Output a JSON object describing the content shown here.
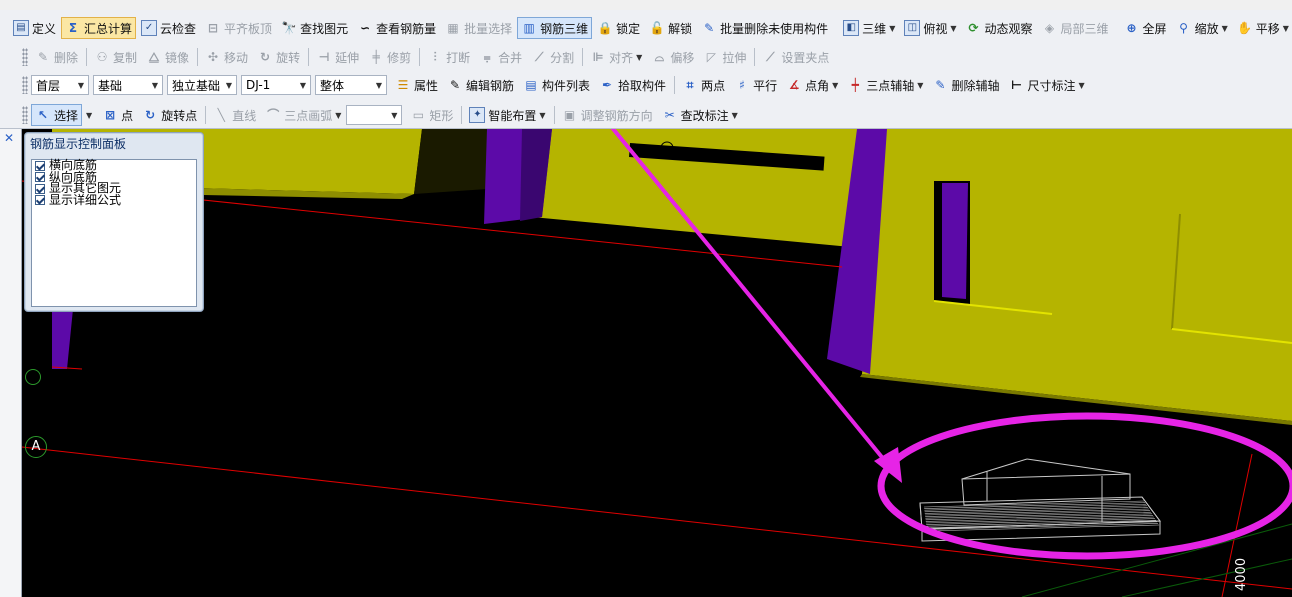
{
  "toolbar1": {
    "items": [
      {
        "label": "定义",
        "icon": "define-icon"
      },
      {
        "label": "汇总计算",
        "icon": "sigma-icon"
      },
      {
        "label": "云检查",
        "icon": "cloud-check-icon"
      },
      {
        "label": "平齐板顶",
        "icon": "align-slab-icon"
      },
      {
        "label": "查找图元",
        "icon": "binoculars-icon"
      },
      {
        "label": "查看钢筋量",
        "icon": "rebar-quantity-icon"
      },
      {
        "label": "批量选择",
        "icon": "batch-select-icon"
      },
      {
        "label": "钢筋三维",
        "icon": "rebar-3d-icon"
      },
      {
        "label": "锁定",
        "icon": "lock-icon"
      },
      {
        "label": "解锁",
        "icon": "unlock-icon"
      },
      {
        "label": "批量删除未使用构件",
        "icon": "batch-delete-icon"
      },
      {
        "label": "三维",
        "icon": "cube-icon"
      },
      {
        "label": "俯视",
        "icon": "top-view-icon"
      },
      {
        "label": "动态观察",
        "icon": "orbit-icon"
      },
      {
        "label": "局部三维",
        "icon": "local-3d-icon"
      },
      {
        "label": "全屏",
        "icon": "zoom-extents-icon"
      },
      {
        "label": "缩放",
        "icon": "zoom-icon"
      },
      {
        "label": "平移",
        "icon": "pan-icon"
      }
    ]
  },
  "toolbar2": {
    "items": [
      {
        "label": "删除",
        "icon": "delete-icon"
      },
      {
        "label": "复制",
        "icon": "copy-icon"
      },
      {
        "label": "镜像",
        "icon": "mirror-icon"
      },
      {
        "label": "移动",
        "icon": "move-icon"
      },
      {
        "label": "旋转",
        "icon": "rotate-icon"
      },
      {
        "label": "延伸",
        "icon": "extend-icon"
      },
      {
        "label": "修剪",
        "icon": "trim-icon"
      },
      {
        "label": "打断",
        "icon": "break-icon"
      },
      {
        "label": "合并",
        "icon": "merge-icon"
      },
      {
        "label": "分割",
        "icon": "split-icon"
      },
      {
        "label": "对齐",
        "icon": "align-icon"
      },
      {
        "label": "偏移",
        "icon": "offset-icon"
      },
      {
        "label": "拉伸",
        "icon": "stretch-icon"
      },
      {
        "label": "设置夹点",
        "icon": "grip-point-icon"
      }
    ]
  },
  "toolbar3": {
    "floor": "首层",
    "category": "基础",
    "type": "独立基础",
    "component": "DJ-1",
    "scope": "整体",
    "items": [
      {
        "label": "属性",
        "icon": "properties-icon"
      },
      {
        "label": "编辑钢筋",
        "icon": "edit-rebar-icon"
      },
      {
        "label": "构件列表",
        "icon": "component-list-icon"
      },
      {
        "label": "拾取构件",
        "icon": "pick-icon"
      },
      {
        "label": "两点",
        "icon": "two-point-icon"
      },
      {
        "label": "平行",
        "icon": "parallel-icon"
      },
      {
        "label": "点角",
        "icon": "point-angle-icon"
      },
      {
        "label": "三点辅轴",
        "icon": "three-point-axis-icon"
      },
      {
        "label": "删除辅轴",
        "icon": "delete-axis-icon"
      },
      {
        "label": "尺寸标注",
        "icon": "dimension-icon"
      }
    ]
  },
  "toolbar4": {
    "items": [
      {
        "label": "选择",
        "icon": "cursor-icon"
      },
      {
        "label": "点",
        "icon": "point-icon"
      },
      {
        "label": "旋转点",
        "icon": "rotate-point-icon"
      },
      {
        "label": "直线",
        "icon": "line-icon"
      },
      {
        "label": "三点画弧",
        "icon": "arc-icon"
      },
      {
        "label": "矩形",
        "icon": "rectangle-icon"
      },
      {
        "label": "智能布置",
        "icon": "smart-layout-icon"
      },
      {
        "label": "调整钢筋方向",
        "icon": "adjust-rebar-icon"
      },
      {
        "label": "查改标注",
        "icon": "edit-annotation-icon"
      }
    ],
    "empty_combo": ""
  },
  "panel": {
    "title": "钢筋显示控制面板",
    "options": [
      "横向底筋",
      "纵向底筋",
      "显示其它图元",
      "显示详细公式"
    ]
  },
  "viewport": {
    "axis_labels": [
      "A"
    ],
    "dimension_label": "4000"
  },
  "colors": {
    "wall_yellow": "#b5b400",
    "column_purple": "#5c0aa8",
    "highlight_magenta": "#e624e6",
    "grid_red": "#e00000",
    "slab_green": "#16c916",
    "toolbar_bg": "#eef0f4"
  }
}
